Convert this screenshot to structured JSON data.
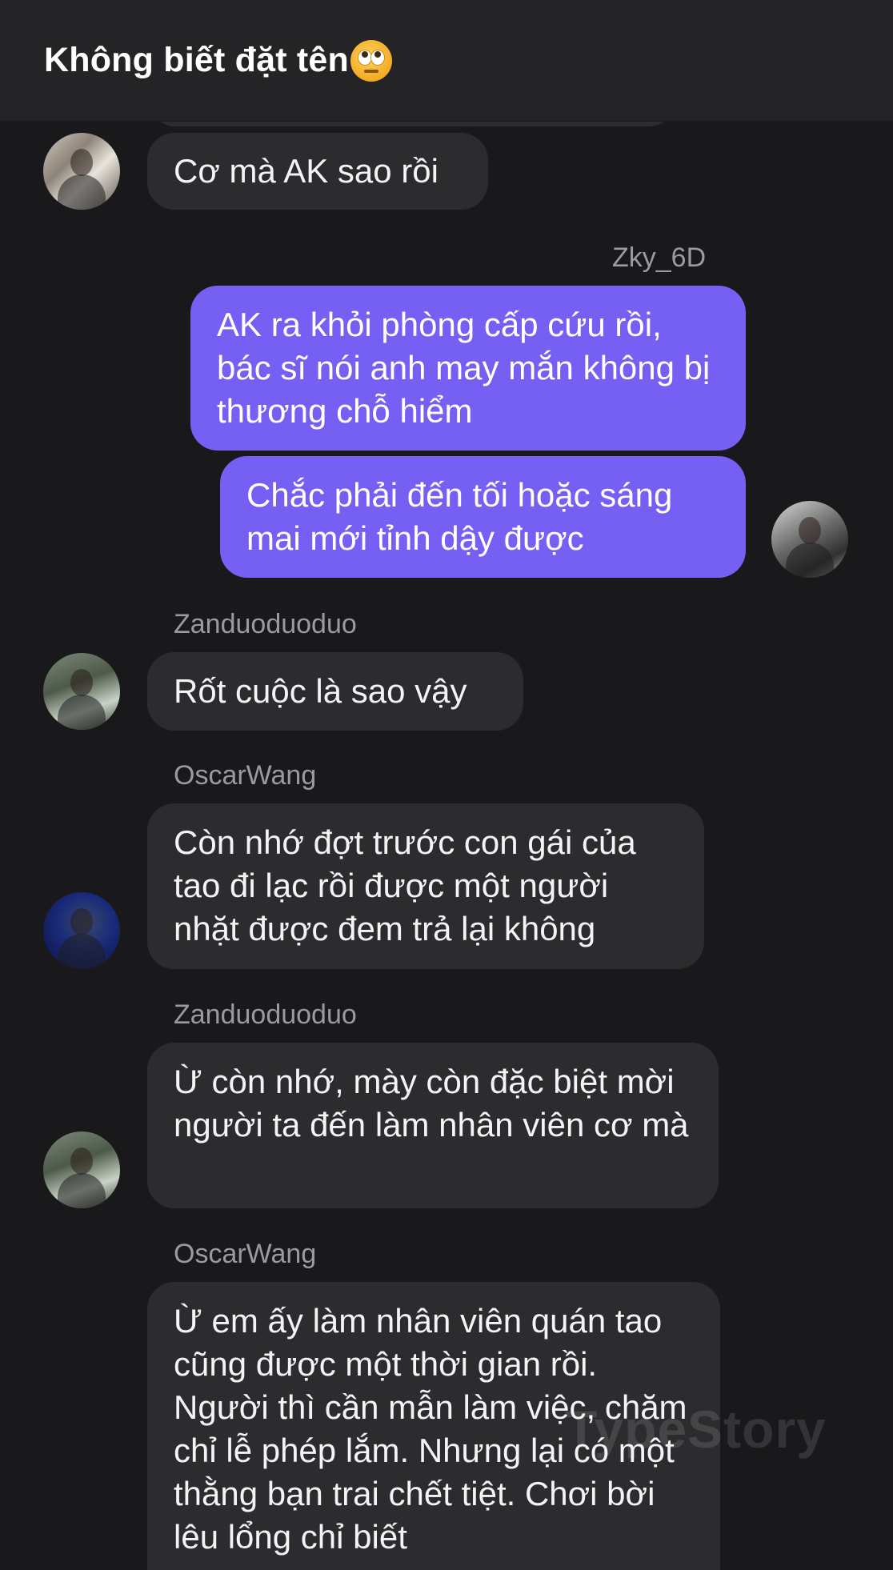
{
  "header": {
    "title": "Không biết đặt tên",
    "emoji_icon": "face-with-rolling-eyes-icon"
  },
  "messages": [
    {
      "sender": "",
      "text": "Cơ mà AK sao rồi"
    },
    {
      "sender": "Zky_6D",
      "text": "AK ra khỏi phòng cấp cứu rồi, bác sĩ nói anh may mắn không bị thương chỗ hiểm"
    },
    {
      "sender": "",
      "text": "Chắc phải đến tối hoặc sáng mai mới tỉnh dậy được"
    },
    {
      "sender": "Zanduoduoduo",
      "text": "Rốt cuộc là sao vậy"
    },
    {
      "sender": "OscarWang",
      "text": "Còn nhớ đợt trước con gái của tao đi lạc rồi được một người nhặt được đem trả lại không"
    },
    {
      "sender": "Zanduoduoduo",
      "text": "Ừ còn nhớ, mày còn đặc biệt mời người ta đến làm nhân viên cơ mà"
    },
    {
      "sender": "OscarWang",
      "text": "Ừ em ấy làm nhân viên quán tao cũng được một thời gian rồi. Người thì cần mẫn làm việc, chăm chỉ lễ phép lắm. Nhưng lại có một thằng bạn trai chết tiệt. Chơi bời lêu lổng chỉ biết"
    }
  ],
  "watermark": "TypeStory",
  "colors": {
    "background": "#19191b",
    "header": "#242426",
    "incoming": "#2c2c2e",
    "outgoing": "#7560f3",
    "sender_name": "#9a9a9f"
  }
}
